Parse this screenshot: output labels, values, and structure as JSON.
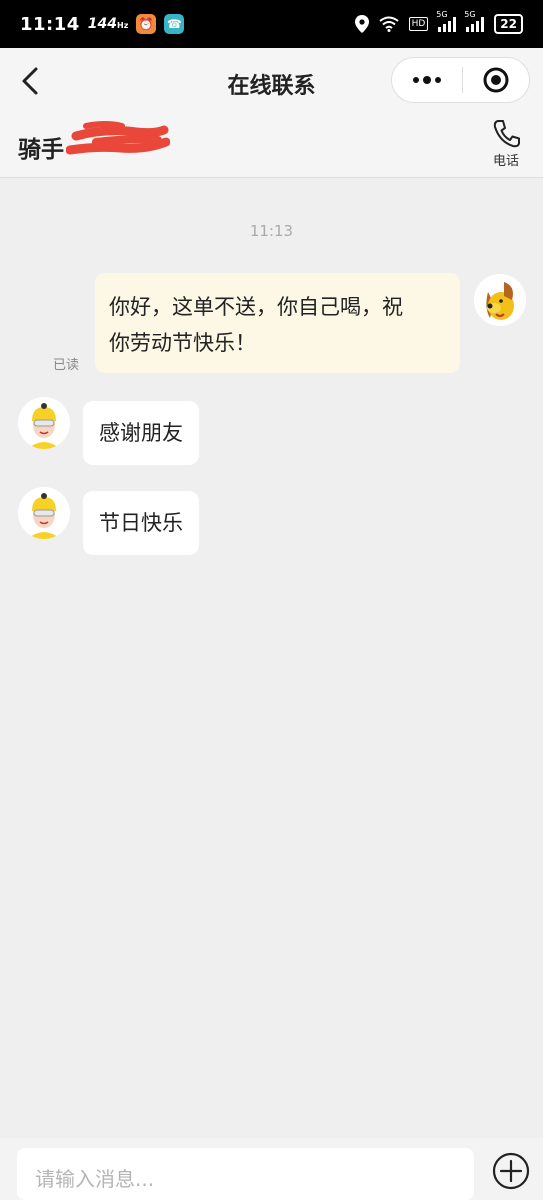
{
  "status_bar": {
    "time": "11:14",
    "refresh_rate": "144",
    "refresh_unit": "Hz",
    "signal_1": "5G",
    "signal_2": "5G",
    "battery": "22",
    "icons": [
      "alarm-app-icon",
      "phone-app-icon",
      "location-icon",
      "wifi-icon",
      "hd-icon",
      "signal-icon",
      "battery-icon"
    ]
  },
  "nav": {
    "title": "在线联系",
    "back_icon": "chevron-left-icon",
    "more_icon": "more-dots-icon",
    "close_icon": "target-close-icon"
  },
  "header": {
    "rider_label": "骑手",
    "call_label": "电话",
    "call_icon": "phone-icon"
  },
  "messages": {
    "timestamp": "11:13",
    "outgoing": {
      "line1": "你好，这单不送，你自己喝，祝",
      "line2": "你劳动节快乐！",
      "status": "已读"
    },
    "incoming": [
      {
        "text": "感谢朋友"
      },
      {
        "text": "节日快乐"
      }
    ]
  },
  "input": {
    "placeholder": "请输入消息...",
    "value": "",
    "plus_icon": "plus-circle-icon"
  },
  "colors": {
    "background": "#efefef",
    "outgoing_bubble": "#fdf8e6",
    "incoming_bubble": "#ffffff",
    "rider_avatar_accent": "#f7d126",
    "redaction": "#e8473a"
  }
}
